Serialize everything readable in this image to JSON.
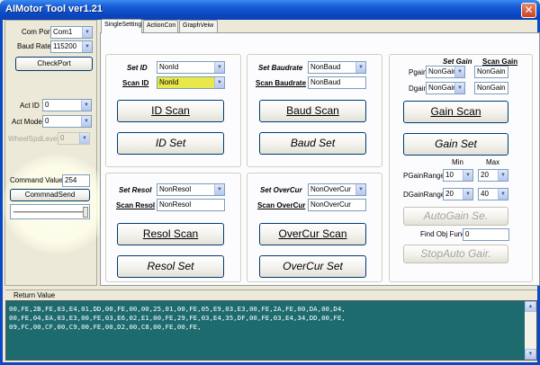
{
  "window": {
    "title": "AIMotor Tool ver1.21",
    "close_glyph": "✕"
  },
  "left": {
    "com_port_label": "Com Port",
    "com_port_value": "Com1",
    "baud_rate_label": "Baud Rate",
    "baud_rate_value": "115200",
    "check_port": "CheckPort",
    "act_id_label": "Act ID",
    "act_id_value": "0",
    "act_mode_label": "Act Mode",
    "act_mode_value": "0",
    "wheel_label": "WheelSpdLevel",
    "wheel_value": "0",
    "command_value_label": "Command Value",
    "command_value": "254",
    "command_send": "CommnadSend"
  },
  "tabs": [
    "SingleSetting",
    "ActionCon",
    "GraphVeiw"
  ],
  "id_group": {
    "set_label": "Set ID",
    "set_value": "NonId",
    "scan_label": "Scan ID",
    "scan_value": "NonId",
    "scan_btn": "ID Scan",
    "set_btn": "ID Set"
  },
  "baud_group": {
    "set_label": "Set Baudrate",
    "set_value": "NonBaud",
    "scan_label": "Scan Baudrate",
    "scan_value": "NonBaud",
    "scan_btn": "Baud Scan",
    "set_btn": "Baud Set"
  },
  "gain_group": {
    "set_label": "Set Gain",
    "scan_label": "Scan Gain",
    "pgain_label": "Pgain",
    "pgain_value": "NonGain",
    "pgain_scan": "NonGain",
    "dgain_label": "Dgain",
    "dgain_value": "NonGain",
    "dgain_scan": "NonGain",
    "scan_btn": "Gain Scan",
    "set_btn": "Gain Set",
    "min_label": "Min",
    "max_label": "Max",
    "pgain_range_label": "PGainRange",
    "pgain_min": "10",
    "pgain_max": "20",
    "dgain_range_label": "DGainRange",
    "dgain_min": "20",
    "dgain_max": "40",
    "auto_btn": "AutoGain Se.",
    "find_label": "Find Obj Func",
    "find_value": "0",
    "stop_btn": "StopAuto Gair."
  },
  "resol_group": {
    "set_label": "Set Resol",
    "set_value": "NonResol",
    "scan_label": "Scan Resol",
    "scan_value": "NonResol",
    "scan_btn": "Resol Scan",
    "set_btn": "Resol Set"
  },
  "overcur_group": {
    "set_label": "Set OverCur",
    "set_value": "NonOverCur",
    "scan_label": "Scan OverCur",
    "scan_value": "NonOverCur",
    "scan_btn": "OverCur Scan",
    "set_btn": "OverCur Set"
  },
  "return": {
    "label": "Return Value",
    "lines": [
      "00,FE,2B,FE,03,E4,01,DD,00,FE,00,00,25,01,00,FE,05,E9,03,E3,00,FE,2A,FE,00,DA,00,D4,",
      "00,FE,04,EA,03,E3,00,FE,03,E6,02,E1,00,FE,29,FE,03,E4,35,DF,00,FE,03,E4,34,DD,00,FE,",
      "09,FC,00,CF,00,C9,00,FE,00,D2,00,C8,00,FE,00,FE,"
    ]
  },
  "colors": {
    "titlebar": "#0a49c5",
    "return_bg": "#1d6b6e",
    "scan_id_highlight": "#e8e84a"
  }
}
